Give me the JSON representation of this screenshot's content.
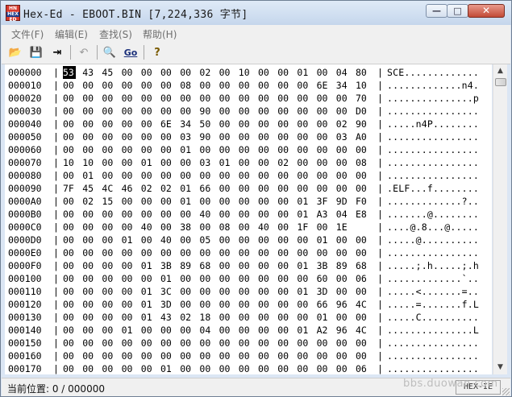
{
  "window": {
    "app_icon_lines": [
      "HN",
      "HEX",
      "ED"
    ],
    "title": "Hex-Ed - EBOOT.BIN [7,224,336 字节]",
    "controls": {
      "minimize": "—",
      "maximize": "□",
      "close": "✕"
    }
  },
  "menu": [
    {
      "label": "文件(F)"
    },
    {
      "label": "编辑(E)"
    },
    {
      "label": "查找(S)"
    },
    {
      "label": "帮助(H)"
    }
  ],
  "toolbar": [
    {
      "name": "open-icon",
      "glyph": "📂"
    },
    {
      "name": "save-icon",
      "glyph": "💾"
    },
    {
      "name": "exit-icon",
      "glyph": "⇥"
    },
    {
      "name": "undo-icon",
      "glyph": "↶"
    },
    {
      "name": "find-icon",
      "glyph": "🔍"
    },
    {
      "name": "goto-icon",
      "glyph": "Go"
    },
    {
      "name": "help-icon",
      "glyph": "?"
    }
  ],
  "hex": {
    "cursor": {
      "row": 0,
      "col": 0
    },
    "rows": [
      {
        "addr": "000000",
        "bytes": [
          "53",
          "43",
          "45",
          "00",
          "00",
          "00",
          "00",
          "02",
          "00",
          "10",
          "00",
          "00",
          "01",
          "00",
          "04",
          "80"
        ],
        "ascii": "SCE............."
      },
      {
        "addr": "000010",
        "bytes": [
          "00",
          "00",
          "00",
          "00",
          "00",
          "00",
          "08",
          "00",
          "00",
          "00",
          "00",
          "00",
          "00",
          "6E",
          "34",
          "10"
        ],
        "ascii": ".............n4."
      },
      {
        "addr": "000020",
        "bytes": [
          "00",
          "00",
          "00",
          "00",
          "00",
          "00",
          "00",
          "00",
          "00",
          "00",
          "00",
          "00",
          "00",
          "00",
          "00",
          "70"
        ],
        "ascii": "...............p"
      },
      {
        "addr": "000030",
        "bytes": [
          "00",
          "00",
          "00",
          "00",
          "00",
          "00",
          "00",
          "90",
          "00",
          "00",
          "00",
          "00",
          "00",
          "00",
          "00",
          "D0"
        ],
        "ascii": "................"
      },
      {
        "addr": "000040",
        "bytes": [
          "00",
          "00",
          "00",
          "00",
          "00",
          "6E",
          "34",
          "50",
          "00",
          "00",
          "00",
          "00",
          "00",
          "00",
          "02",
          "90"
        ],
        "ascii": ".....n4P........"
      },
      {
        "addr": "000050",
        "bytes": [
          "00",
          "00",
          "00",
          "00",
          "00",
          "00",
          "03",
          "90",
          "00",
          "00",
          "00",
          "00",
          "00",
          "00",
          "03",
          "A0"
        ],
        "ascii": "................"
      },
      {
        "addr": "000060",
        "bytes": [
          "00",
          "00",
          "00",
          "00",
          "00",
          "00",
          "01",
          "00",
          "00",
          "00",
          "00",
          "00",
          "00",
          "00",
          "00",
          "00"
        ],
        "ascii": "................"
      },
      {
        "addr": "000070",
        "bytes": [
          "10",
          "10",
          "00",
          "00",
          "01",
          "00",
          "00",
          "03",
          "01",
          "00",
          "00",
          "02",
          "00",
          "00",
          "00",
          "08"
        ],
        "ascii": "................"
      },
      {
        "addr": "000080",
        "bytes": [
          "00",
          "01",
          "00",
          "00",
          "00",
          "00",
          "00",
          "00",
          "00",
          "00",
          "00",
          "00",
          "00",
          "00",
          "00",
          "00"
        ],
        "ascii": "................"
      },
      {
        "addr": "000090",
        "bytes": [
          "7F",
          "45",
          "4C",
          "46",
          "02",
          "02",
          "01",
          "66",
          "00",
          "00",
          "00",
          "00",
          "00",
          "00",
          "00",
          "00"
        ],
        "ascii": ".ELF...f........"
      },
      {
        "addr": "0000A0",
        "bytes": [
          "00",
          "02",
          "15",
          "00",
          "00",
          "00",
          "01",
          "00",
          "00",
          "00",
          "00",
          "00",
          "01",
          "3F",
          "9D",
          "F0"
        ],
        "ascii": ".............?.."
      },
      {
        "addr": "0000B0",
        "bytes": [
          "00",
          "00",
          "00",
          "00",
          "00",
          "00",
          "00",
          "40",
          "00",
          "00",
          "00",
          "00",
          "01",
          "A3",
          "04",
          "E8"
        ],
        "ascii": ".......@........"
      },
      {
        "addr": "0000C0",
        "bytes": [
          "00",
          "00",
          "00",
          "00",
          "40",
          "00",
          "38",
          "00",
          "08",
          "00",
          "40",
          "00",
          "1F",
          "00",
          "1E"
        ],
        "ascii": "....@.8...@....."
      },
      {
        "addr": "0000D0",
        "bytes": [
          "00",
          "00",
          "00",
          "01",
          "00",
          "40",
          "00",
          "05",
          "00",
          "00",
          "00",
          "00",
          "00",
          "01",
          "00",
          "00"
        ],
        "ascii": ".....@.........."
      },
      {
        "addr": "0000E0",
        "bytes": [
          "00",
          "00",
          "00",
          "00",
          "00",
          "00",
          "00",
          "00",
          "00",
          "00",
          "00",
          "00",
          "00",
          "00",
          "00",
          "00"
        ],
        "ascii": "................"
      },
      {
        "addr": "0000F0",
        "bytes": [
          "00",
          "00",
          "00",
          "00",
          "01",
          "3B",
          "89",
          "68",
          "00",
          "00",
          "00",
          "00",
          "01",
          "3B",
          "89",
          "68"
        ],
        "ascii": ".....;.h.....;.h"
      },
      {
        "addr": "000100",
        "bytes": [
          "00",
          "00",
          "00",
          "00",
          "00",
          "01",
          "00",
          "00",
          "00",
          "00",
          "00",
          "00",
          "00",
          "60",
          "00",
          "06"
        ],
        "ascii": ".............`.."
      },
      {
        "addr": "000110",
        "bytes": [
          "00",
          "00",
          "00",
          "00",
          "01",
          "3C",
          "00",
          "00",
          "00",
          "00",
          "00",
          "00",
          "01",
          "3D",
          "00",
          "00"
        ],
        "ascii": ".....<.......=.."
      },
      {
        "addr": "000120",
        "bytes": [
          "00",
          "00",
          "00",
          "00",
          "01",
          "3D",
          "00",
          "00",
          "00",
          "00",
          "00",
          "00",
          "00",
          "66",
          "96",
          "4C"
        ],
        "ascii": ".....=.......f.L"
      },
      {
        "addr": "000130",
        "bytes": [
          "00",
          "00",
          "00",
          "00",
          "01",
          "43",
          "02",
          "18",
          "00",
          "00",
          "00",
          "00",
          "00",
          "01",
          "00",
          "00"
        ],
        "ascii": ".....C.........."
      },
      {
        "addr": "000140",
        "bytes": [
          "00",
          "00",
          "00",
          "01",
          "00",
          "00",
          "00",
          "04",
          "00",
          "00",
          "00",
          "00",
          "01",
          "A2",
          "96",
          "4C"
        ],
        "ascii": "...............L"
      },
      {
        "addr": "000150",
        "bytes": [
          "00",
          "00",
          "00",
          "00",
          "00",
          "00",
          "00",
          "00",
          "00",
          "00",
          "00",
          "00",
          "00",
          "00",
          "00",
          "00"
        ],
        "ascii": "................"
      },
      {
        "addr": "000160",
        "bytes": [
          "00",
          "00",
          "00",
          "00",
          "00",
          "00",
          "00",
          "00",
          "00",
          "00",
          "00",
          "00",
          "00",
          "00",
          "00",
          "00"
        ],
        "ascii": "................"
      },
      {
        "addr": "000170",
        "bytes": [
          "00",
          "00",
          "00",
          "00",
          "00",
          "01",
          "00",
          "00",
          "00",
          "00",
          "00",
          "00",
          "00",
          "00",
          "00",
          "06"
        ],
        "ascii": "................"
      }
    ]
  },
  "status": {
    "position_text": "当前位置: 0 / 000000",
    "mode": "HEX-IE"
  },
  "watermark": "bbs.duowan.com"
}
